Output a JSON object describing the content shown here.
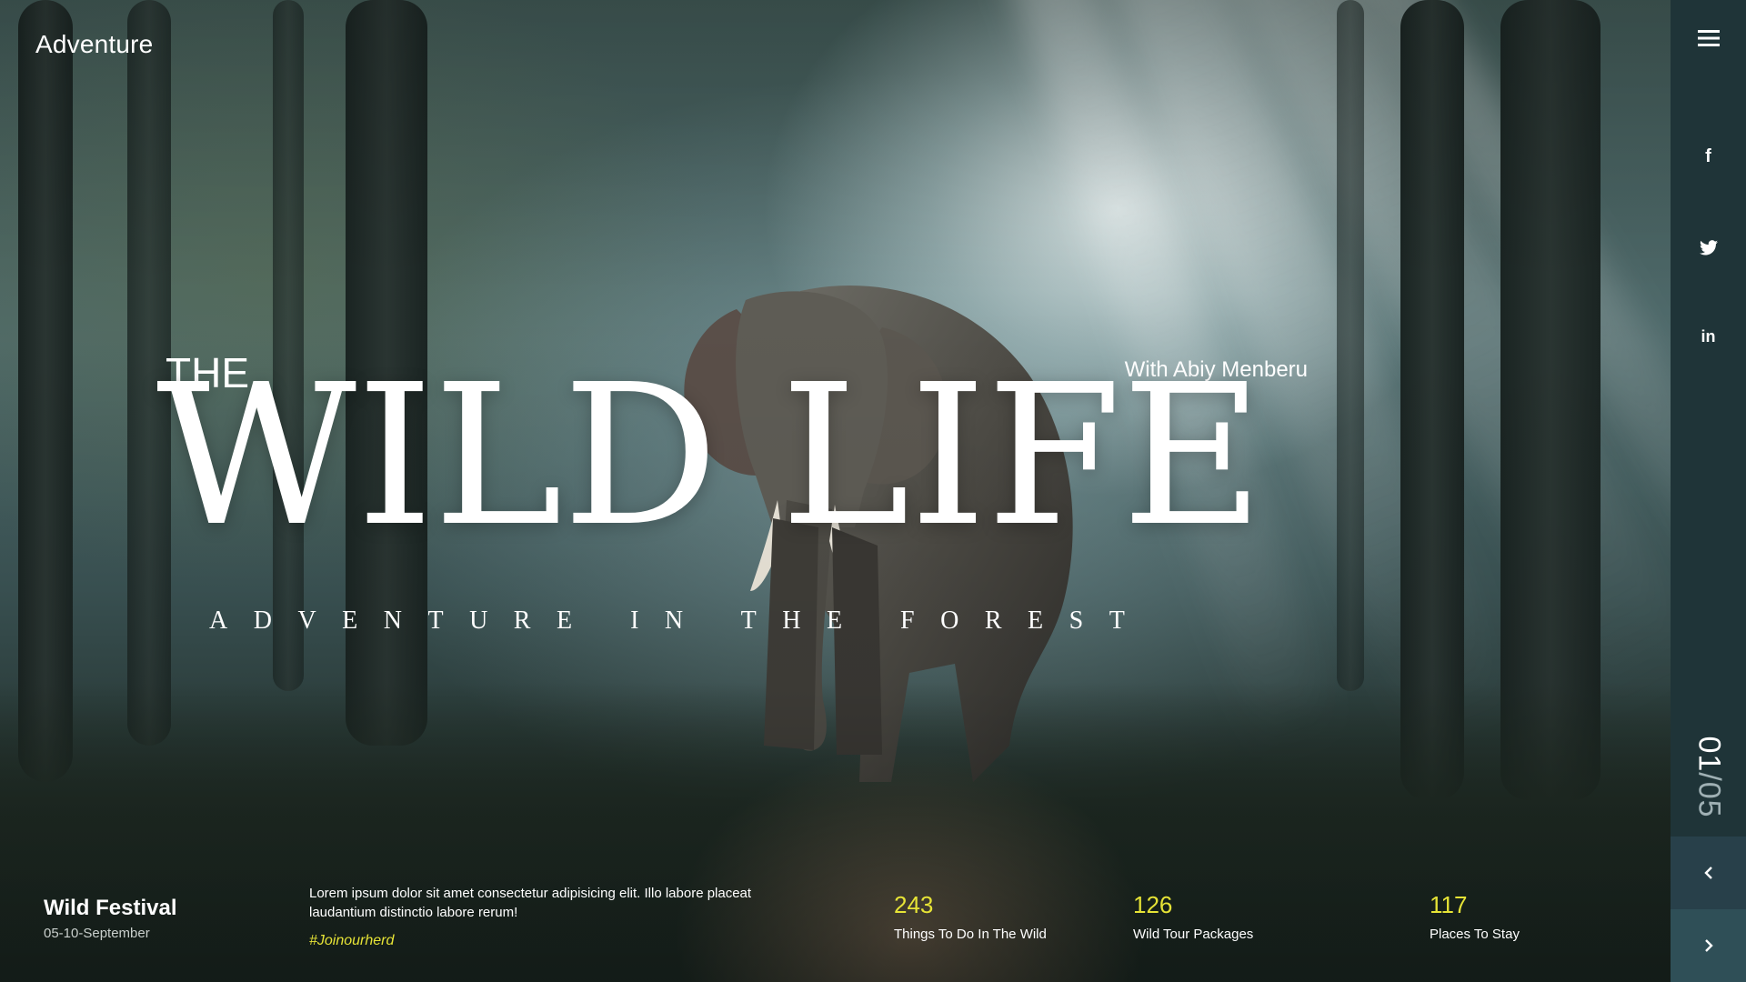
{
  "brand": {
    "name": "Adventure"
  },
  "hero": {
    "pre_title": "THE",
    "title": "WILD LIFE",
    "byline": "With Abiy Menberu",
    "subtitle": "ADVENTURE IN THE FOREST"
  },
  "sidebar": {
    "menu_icon": "hamburger-menu-icon",
    "social": [
      {
        "name": "facebook",
        "icon": "facebook-icon",
        "glyph": "f"
      },
      {
        "name": "twitter",
        "icon": "twitter-icon"
      },
      {
        "name": "linkedin",
        "icon": "linkedin-icon",
        "glyph": "in"
      }
    ],
    "slide_counter": {
      "current": "01",
      "separator": "/",
      "total": "05"
    },
    "prev_icon": "chevron-left-icon",
    "next_icon": "chevron-right-icon"
  },
  "footer": {
    "event": {
      "title": "Wild Festival",
      "date": "05-10-September"
    },
    "description": "Lorem ipsum dolor sit amet consectetur adipisicing elit. Illo labore placeat laudantium distinctio labore rerum!",
    "hashtag": "#Joinourherd",
    "stats": [
      {
        "value": "243",
        "label": "Things To Do In The Wild"
      },
      {
        "value": "126",
        "label": "Wild Tour Packages"
      },
      {
        "value": "117",
        "label": "Places To Stay"
      }
    ]
  },
  "colors": {
    "accent": "#e6e336",
    "rail": "#1f3438",
    "next_button": "#2f4f57"
  }
}
